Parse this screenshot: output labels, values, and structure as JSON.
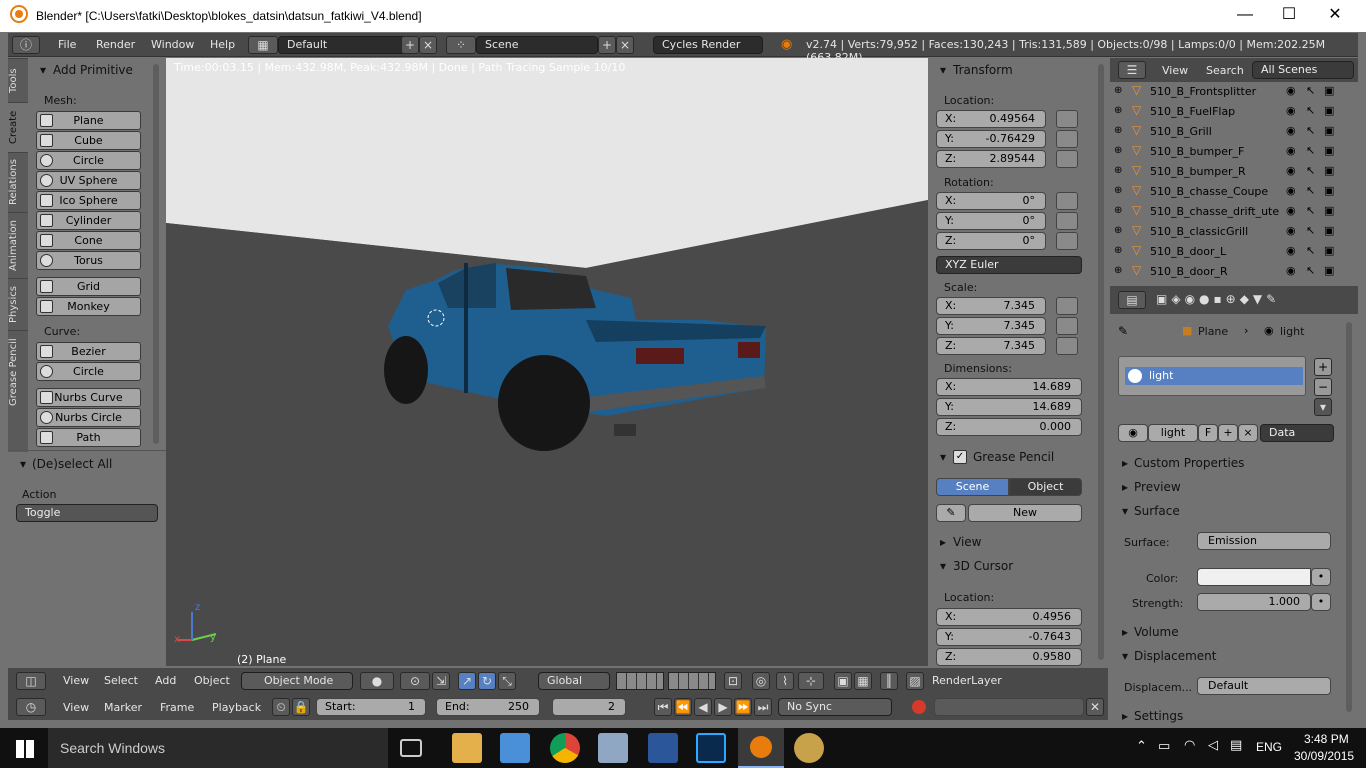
{
  "window": {
    "title": "Blender* [C:\\Users\\fatki\\Desktop\\blokes_datsin\\datsun_fatkiwi_V4.blend]",
    "minimize": "—",
    "maximize": "☐",
    "close": "✕"
  },
  "topbar": {
    "menus": [
      "File",
      "Render",
      "Window",
      "Help"
    ],
    "layout": "Default",
    "scene": "Scene",
    "engine": "Cycles Render",
    "stats": "v2.74 | Verts:79,952 | Faces:130,243 | Tris:131,589 | Objects:0/98 | Lamps:0/0 | Mem:202.25M (663.82M)"
  },
  "tabs": [
    "Tools",
    "Create",
    "Relations",
    "Animation",
    "Physics",
    "Grease Pencil"
  ],
  "toolshelf": {
    "title": "Add Primitive",
    "mesh_label": "Mesh:",
    "mesh": [
      "Plane",
      "Cube",
      "Circle",
      "UV Sphere",
      "Ico Sphere",
      "Cylinder",
      "Cone",
      "Torus",
      "Grid",
      "Monkey"
    ],
    "curve_label": "Curve:",
    "curve": [
      "Bezier",
      "Circle",
      "Nurbs Curve",
      "Nurbs Circle",
      "Path"
    ],
    "op_title": "(De)select All",
    "action_label": "Action",
    "action_value": "Toggle"
  },
  "viewport": {
    "info": "Time:00:03.15 | Mem:432.98M, Peak:432.98M | Done | Path Tracing Sample 10/10",
    "object_label": "(2) Plane",
    "axis_x": "x",
    "axis_y": "y",
    "axis_z": "z"
  },
  "npanel": {
    "transform": "Transform",
    "location_label": "Location:",
    "location": [
      {
        "axis": "X:",
        "value": "0.49564"
      },
      {
        "axis": "Y:",
        "value": "-0.76429"
      },
      {
        "axis": "Z:",
        "value": "2.89544"
      }
    ],
    "rotation_label": "Rotation:",
    "rotation": [
      {
        "axis": "X:",
        "value": "0°"
      },
      {
        "axis": "Y:",
        "value": "0°"
      },
      {
        "axis": "Z:",
        "value": "0°"
      }
    ],
    "rot_mode": "XYZ Euler",
    "scale_label": "Scale:",
    "scale": [
      {
        "axis": "X:",
        "value": "7.345"
      },
      {
        "axis": "Y:",
        "value": "7.345"
      },
      {
        "axis": "Z:",
        "value": "7.345"
      }
    ],
    "dims_label": "Dimensions:",
    "dims": [
      {
        "axis": "X:",
        "value": "14.689"
      },
      {
        "axis": "Y:",
        "value": "14.689"
      },
      {
        "axis": "Z:",
        "value": "0.000"
      }
    ],
    "grease": "Grease Pencil",
    "gp_scene": "Scene",
    "gp_object": "Object",
    "gp_new": "New",
    "view": "View",
    "cursor": "3D Cursor",
    "cursor_loc_label": "Location:",
    "cursor_loc": [
      {
        "axis": "X:",
        "value": "0.4956"
      },
      {
        "axis": "Y:",
        "value": "-0.7643"
      },
      {
        "axis": "Z:",
        "value": "0.9580"
      }
    ]
  },
  "outliner": {
    "view": "View",
    "search": "Search",
    "scenes": "All Scenes",
    "rows": [
      "510_B_Frontsplitter",
      "510_B_FuelFlap",
      "510_B_Grill",
      "510_B_bumper_F",
      "510_B_bumper_R",
      "510_B_chasse_Coupe",
      "510_B_chasse_drift_ute",
      "510_B_classicGrill",
      "510_B_door_L",
      "510_B_door_R"
    ]
  },
  "props": {
    "crumb_obj": "Plane",
    "crumb_mat": "light",
    "slot": "light",
    "mat_name": "light",
    "mat_f": "F",
    "data_drop": "Data",
    "custom": "Custom Properties",
    "preview": "Preview",
    "surface": "Surface",
    "surface_label": "Surface:",
    "surface_value": "Emission",
    "color_label": "Color:",
    "strength_label": "Strength:",
    "strength": "1.000",
    "volume": "Volume",
    "displacement": "Displacement",
    "disp_label": "Displacem...",
    "disp_value": "Default",
    "settings": "Settings"
  },
  "viewhdr": {
    "menus": [
      "View",
      "Select",
      "Add",
      "Object"
    ],
    "mode": "Object Mode",
    "orient": "Global",
    "layer": "RenderLayer"
  },
  "timeline": {
    "menus": [
      "View",
      "Marker",
      "Frame",
      "Playback"
    ],
    "start_label": "Start:",
    "start": "1",
    "end_label": "End:",
    "end": "250",
    "current": "2",
    "sync": "No Sync"
  },
  "taskbar": {
    "search": "Search Windows",
    "lang": "ENG",
    "time": "3:48 PM",
    "date": "30/09/2015"
  },
  "colors": {
    "accent": "#5680c2",
    "car": "#1f5f8f",
    "blender": "#e87d0d"
  }
}
